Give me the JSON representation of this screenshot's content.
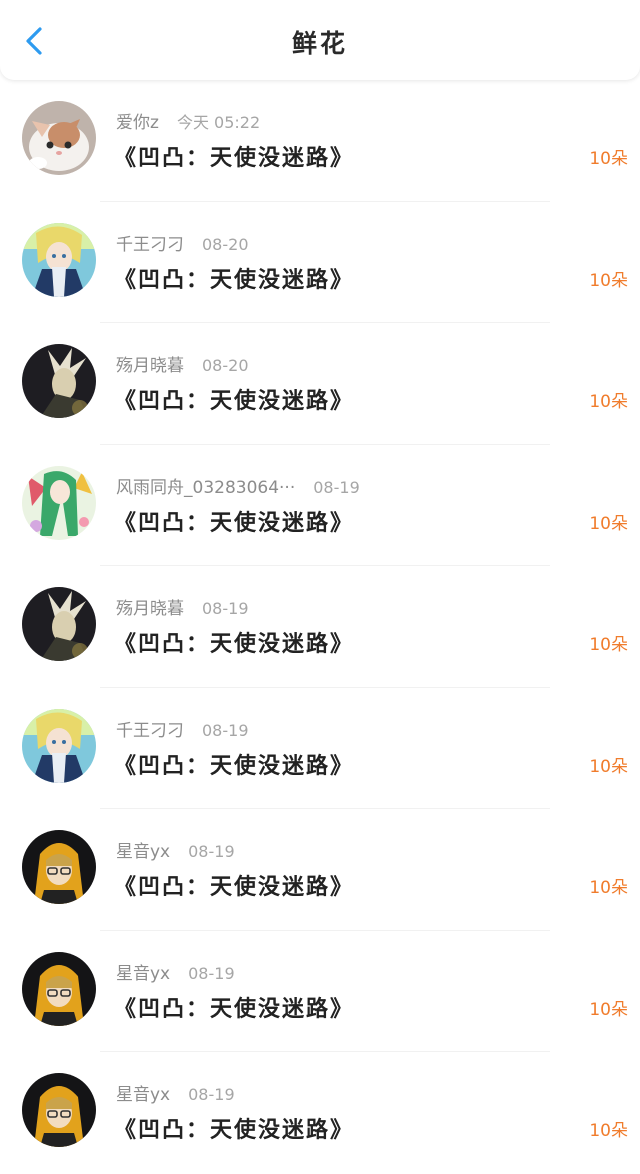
{
  "header": {
    "title": "鲜花"
  },
  "colors": {
    "accent": "#2e9bf0",
    "flowers": "#f07c2c"
  },
  "icons": {
    "back": "back-arrow-icon"
  },
  "items": [
    {
      "user": "爱你z",
      "time": "今天 05:22",
      "book": "《凹凸：天使没迷路》",
      "count": "10朵",
      "avatar": "kitten-photo"
    },
    {
      "user": "千王刁刁",
      "time": "08-20",
      "book": "《凹凸：天使没迷路》",
      "count": "10朵",
      "avatar": "anime-blonde-scarf"
    },
    {
      "user": "殇月晓暮",
      "time": "08-20",
      "book": "《凹凸：天使没迷路》",
      "count": "10朵",
      "avatar": "anime-white-hair-dark"
    },
    {
      "user": "风雨同舟_03283064···",
      "time": "08-19",
      "book": "《凹凸：天使没迷路》",
      "count": "10朵",
      "avatar": "anime-green-hair"
    },
    {
      "user": "殇月晓暮",
      "time": "08-19",
      "book": "《凹凸：天使没迷路》",
      "count": "10朵",
      "avatar": "anime-white-hair-dark"
    },
    {
      "user": "千王刁刁",
      "time": "08-19",
      "book": "《凹凸：天使没迷路》",
      "count": "10朵",
      "avatar": "anime-blonde-scarf"
    },
    {
      "user": "星音yx",
      "time": "08-19",
      "book": "《凹凸：天使没迷路》",
      "count": "10朵",
      "avatar": "anime-hooded-glasses"
    },
    {
      "user": "星音yx",
      "time": "08-19",
      "book": "《凹凸：天使没迷路》",
      "count": "10朵",
      "avatar": "anime-hooded-glasses"
    },
    {
      "user": "星音yx",
      "time": "08-19",
      "book": "《凹凸：天使没迷路》",
      "count": "10朵",
      "avatar": "anime-hooded-glasses"
    }
  ]
}
